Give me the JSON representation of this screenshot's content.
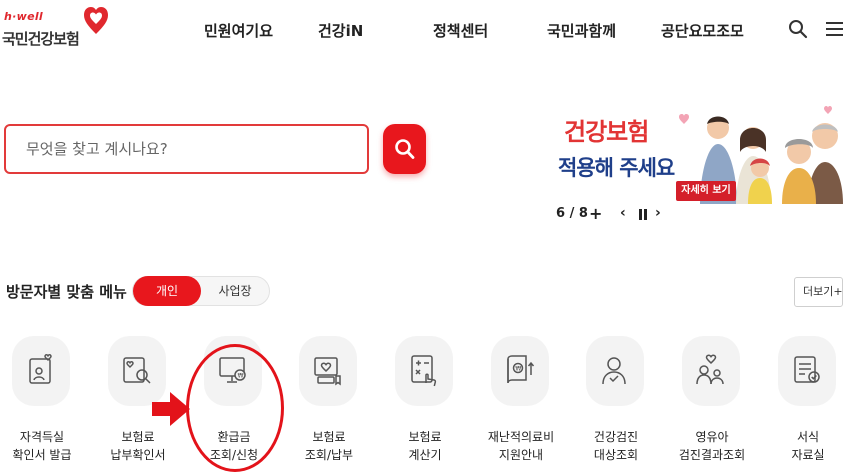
{
  "header": {
    "logo_brand": "h·well",
    "logo_name": "국민건강보험",
    "nav": [
      "민원여기요",
      "건강iN",
      "정책센터",
      "국민과함께",
      "공단요모조모"
    ]
  },
  "search": {
    "placeholder": "무엇을 찾고 계시나요?"
  },
  "banner": {
    "title_line1": "건강보험",
    "title_line2": "적용해 주세요",
    "cta": "자세히 보기",
    "pager": "6 / 8",
    "plus": "+",
    "prev": "‹",
    "next": "›"
  },
  "menu": {
    "title": "방문자별 맞춤 메뉴",
    "toggle_personal": "개인",
    "toggle_business": "사업장",
    "more": "더보기+",
    "tiles": [
      {
        "line1": "자격득실",
        "line2": "확인서 발급"
      },
      {
        "line1": "보험료",
        "line2": "납부확인서"
      },
      {
        "line1": "환급금",
        "line2": "조회/신청"
      },
      {
        "line1": "보험료",
        "line2": "조회/납부"
      },
      {
        "line1": "보험료",
        "line2": "계산기"
      },
      {
        "line1": "재난적의료비",
        "line2": "지원안내"
      },
      {
        "line1": "건강검진",
        "line2": "대상조회"
      },
      {
        "line1": "영유아",
        "line2": "검진결과조회"
      },
      {
        "line1": "서식",
        "line2": "자료실"
      }
    ]
  },
  "colors": {
    "brand_red": "#e8171d",
    "banner_blue": "#1f3f8a",
    "tile_bg": "#f3f3f3"
  }
}
